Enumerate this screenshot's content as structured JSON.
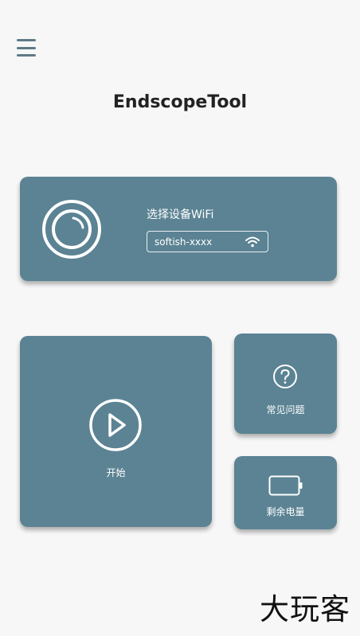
{
  "header": {
    "menu_icon": "hamburger-menu-icon",
    "title": "EndscopeTool"
  },
  "wifi_card": {
    "lens_icon": "camera-lens-icon",
    "label": "选择设备WiFi",
    "selected_wifi": "softish-xxxx",
    "wifi_icon": "wifi-icon"
  },
  "start_card": {
    "icon": "play-circle-icon",
    "label": "开始"
  },
  "faq_card": {
    "icon": "question-circle-icon",
    "label": "常见问题"
  },
  "battery_card": {
    "icon": "battery-icon",
    "label": "剩余电量"
  },
  "watermark": "大玩客",
  "colors": {
    "card_background": "#5b8393",
    "page_background": "#f7f7f7",
    "menu_icon": "#5f7a87",
    "card_text": "#ffffff"
  }
}
